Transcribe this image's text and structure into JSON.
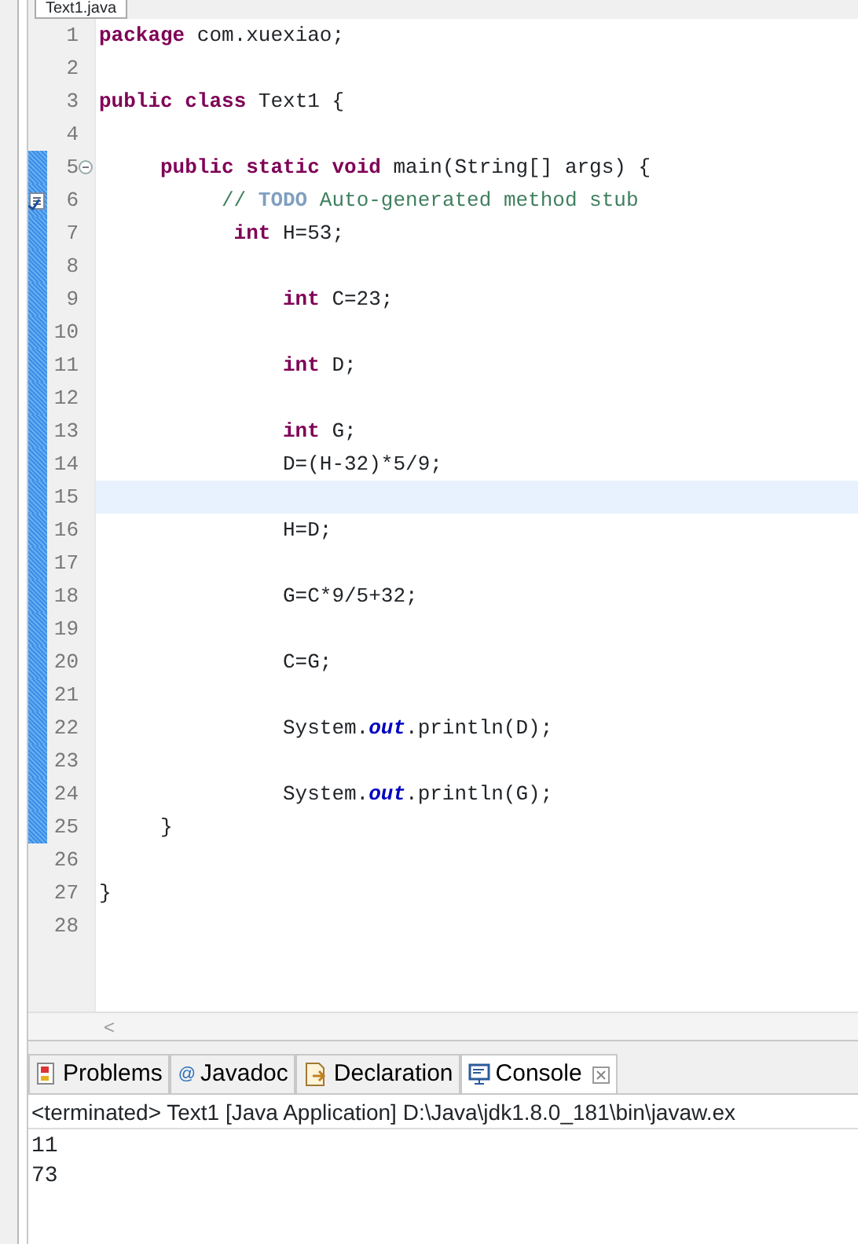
{
  "editor_tab": {
    "title": "Text1.java"
  },
  "lines": [
    {
      "number": "1",
      "changed": false,
      "current": false,
      "kind": "top",
      "tokens": [
        {
          "kind": "keyword",
          "text": "package"
        },
        {
          "kind": "plain",
          "text": " com.xuexiao;"
        }
      ]
    },
    {
      "number": "2",
      "changed": false,
      "current": false
    },
    {
      "number": "3",
      "changed": false,
      "current": false,
      "kind": "top",
      "tokens": [
        {
          "kind": "keyword",
          "text": "public class"
        },
        {
          "kind": "plain",
          "text": " Text1 {"
        }
      ]
    },
    {
      "number": "4",
      "changed": false,
      "current": false
    },
    {
      "number": "5",
      "changed": true,
      "current": false,
      "fold": true,
      "kind": "member",
      "tokens": [
        {
          "kind": "keyword",
          "text": "public static void"
        },
        {
          "kind": "plain",
          "text": " main(String[] args) {"
        }
      ]
    },
    {
      "number": "6",
      "changed": true,
      "current": false,
      "task": true,
      "kind": "comment",
      "tokens": [
        {
          "kind": "comment",
          "text": "// "
        },
        {
          "kind": "todo",
          "text": "TODO"
        },
        {
          "kind": "comment",
          "text": " Auto-generated method stub"
        }
      ]
    },
    {
      "number": "7",
      "changed": true,
      "current": false,
      "kind": "first",
      "tokens": [
        {
          "kind": "keyword",
          "text": "int"
        },
        {
          "kind": "plain",
          "text": " H=53;"
        }
      ]
    },
    {
      "number": "8",
      "changed": true,
      "current": false
    },
    {
      "number": "9",
      "changed": true,
      "current": false,
      "kind": "statement",
      "tokens": [
        {
          "kind": "keyword",
          "text": "int"
        },
        {
          "kind": "plain",
          "text": " C=23;"
        }
      ]
    },
    {
      "number": "10",
      "changed": true,
      "current": false
    },
    {
      "number": "11",
      "changed": true,
      "current": false,
      "kind": "statement",
      "tokens": [
        {
          "kind": "keyword",
          "text": "int"
        },
        {
          "kind": "plain",
          "text": " D;"
        }
      ]
    },
    {
      "number": "12",
      "changed": true,
      "current": false
    },
    {
      "number": "13",
      "changed": true,
      "current": false,
      "kind": "statement",
      "tokens": [
        {
          "kind": "keyword",
          "text": "int"
        },
        {
          "kind": "plain",
          "text": " G;"
        }
      ]
    },
    {
      "number": "14",
      "changed": true,
      "current": false,
      "kind": "statement",
      "tokens": [
        {
          "kind": "plain",
          "text": "D=(H-32)*5/9;"
        }
      ]
    },
    {
      "number": "15",
      "changed": true,
      "current": true
    },
    {
      "number": "16",
      "changed": true,
      "current": false,
      "kind": "statement",
      "tokens": [
        {
          "kind": "plain",
          "text": "H=D;"
        }
      ]
    },
    {
      "number": "17",
      "changed": true,
      "current": false
    },
    {
      "number": "18",
      "changed": true,
      "current": false,
      "kind": "statement",
      "tokens": [
        {
          "kind": "plain",
          "text": "G=C*9/5+32;"
        }
      ]
    },
    {
      "number": "19",
      "changed": true,
      "current": false
    },
    {
      "number": "20",
      "changed": true,
      "current": false,
      "kind": "statement",
      "tokens": [
        {
          "kind": "plain",
          "text": "C=G;"
        }
      ]
    },
    {
      "number": "21",
      "changed": true,
      "current": false
    },
    {
      "number": "22",
      "changed": true,
      "current": false,
      "kind": "statement",
      "tokens": [
        {
          "kind": "plain",
          "text": "System."
        },
        {
          "kind": "field",
          "text": "out"
        },
        {
          "kind": "plain",
          "text": ".println(D);"
        }
      ]
    },
    {
      "number": "23",
      "changed": true,
      "current": false
    },
    {
      "number": "24",
      "changed": true,
      "current": false,
      "kind": "statement",
      "tokens": [
        {
          "kind": "plain",
          "text": "System."
        },
        {
          "kind": "field",
          "text": "out"
        },
        {
          "kind": "plain",
          "text": ".println(G);"
        }
      ]
    },
    {
      "number": "25",
      "changed": true,
      "current": false,
      "kind": "member",
      "tokens": [
        {
          "kind": "plain",
          "text": "}"
        }
      ]
    },
    {
      "number": "26",
      "changed": false,
      "current": false
    },
    {
      "number": "27",
      "changed": false,
      "current": false,
      "kind": "top",
      "tokens": [
        {
          "kind": "plain",
          "text": "}"
        }
      ]
    },
    {
      "number": "28",
      "changed": false,
      "current": false
    }
  ],
  "scrollbar": {
    "arrow": "<"
  },
  "panel_tabs": [
    {
      "kind": "problems",
      "label": "Problems",
      "selected": false
    },
    {
      "kind": "javadoc",
      "icon": "@",
      "label": "Javadoc",
      "selected": false
    },
    {
      "kind": "declaration",
      "label": "Declaration",
      "selected": false
    },
    {
      "kind": "console",
      "label": "Console",
      "selected": true
    }
  ],
  "console": {
    "header": "<terminated> Text1 [Java Application] D:\\Java\\jdk1.8.0_181\\bin\\javaw.ex",
    "output": [
      "11",
      "73"
    ]
  }
}
